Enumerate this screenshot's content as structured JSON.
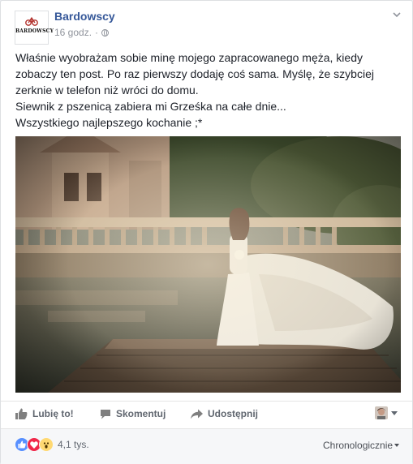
{
  "post": {
    "page_name": "Bardowscy",
    "avatar_text": "BARDOWSCY",
    "time": "16 godz.",
    "separator": "·",
    "privacy_icon": "globe-icon",
    "menu_icon": "chevron-down-icon",
    "text_lines": [
      "Właśnie wyobrażam sobie minę mojego zapracowanego męża, kiedy",
      "zobaczy ten post. Po raz pierwszy dodaję coś sama. Myślę, że szybciej",
      "zerknie w telefon niż wróci do domu.",
      "Siewnik z pszenicą zabiera mi Grześka na całe dnie...",
      "Wszystkiego najlepszego kochanie ;*"
    ]
  },
  "actions": {
    "like": "Lubię to!",
    "comment": "Skomentuj",
    "share": "Udostępnij"
  },
  "footer": {
    "reactions": [
      "like",
      "love",
      "wow"
    ],
    "reaction_count": "4,1 tys.",
    "sort_label": "Chronologicznie"
  },
  "colors": {
    "link": "#365899",
    "like": "#5890ff",
    "love": "#f0284a",
    "wow": "#ffd972"
  }
}
